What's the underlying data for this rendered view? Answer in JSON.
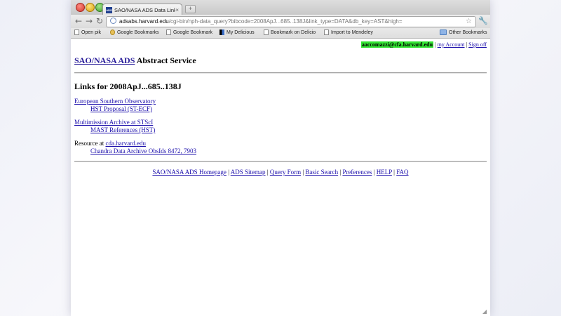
{
  "browser": {
    "tab_title": "SAO/NASA ADS Data Links",
    "tab_favicon": "ADS",
    "tab_close": "×",
    "new_tab": "+",
    "url_host": "adsabs.harvard.edu",
    "url_path": "/cgi-bin/nph-data_query?bibcode=2008ApJ...685..138J&link_type=DATA&db_key=AST&high=",
    "back": "←",
    "forward": "→",
    "reload": "↻",
    "star": "☆",
    "wrench": "🔧",
    "bookmarks": [
      {
        "label": "Open pik",
        "icon": "page-icon"
      },
      {
        "label": "Google Bookmarks",
        "icon": "google-icon"
      },
      {
        "label": "Google Bookmark",
        "icon": "page-icon"
      },
      {
        "label": "My Delicious",
        "icon": "delicious-icon"
      },
      {
        "label": "Bookmark on Delicio",
        "icon": "page-icon"
      },
      {
        "label": "Import to Mendeley",
        "icon": "page-icon"
      }
    ],
    "other_bookmarks": "Other Bookmarks"
  },
  "page": {
    "user": {
      "email": "aaccomazzi@cfa.harvard.edu",
      "sep1": " | ",
      "my_account": "my Account",
      "sep2": " | ",
      "sign_off": "Sign off"
    },
    "heading_link": "SAO/NASA ADS",
    "heading_rest": " Abstract Service",
    "links_title": "Links for 2008ApJ...685..138J",
    "entries": [
      {
        "main_link": "European Southern Observatory",
        "sub_link": "HST Proposal (ST-ECF)"
      },
      {
        "main_link": "Multimission Archive at STScI",
        "sub_link": "MAST References (HST)"
      },
      {
        "prefix": "Resource at ",
        "main_link": "cda.harvard.edu",
        "sub_link": "Chandra Data Archive ObsIds 8472, 7903"
      }
    ],
    "footer": [
      "SAO/NASA ADS Homepage",
      "ADS Sitemap",
      "Query Form",
      "Basic Search",
      "Preferences",
      "HELP",
      "FAQ"
    ],
    "footer_sep": " | "
  }
}
